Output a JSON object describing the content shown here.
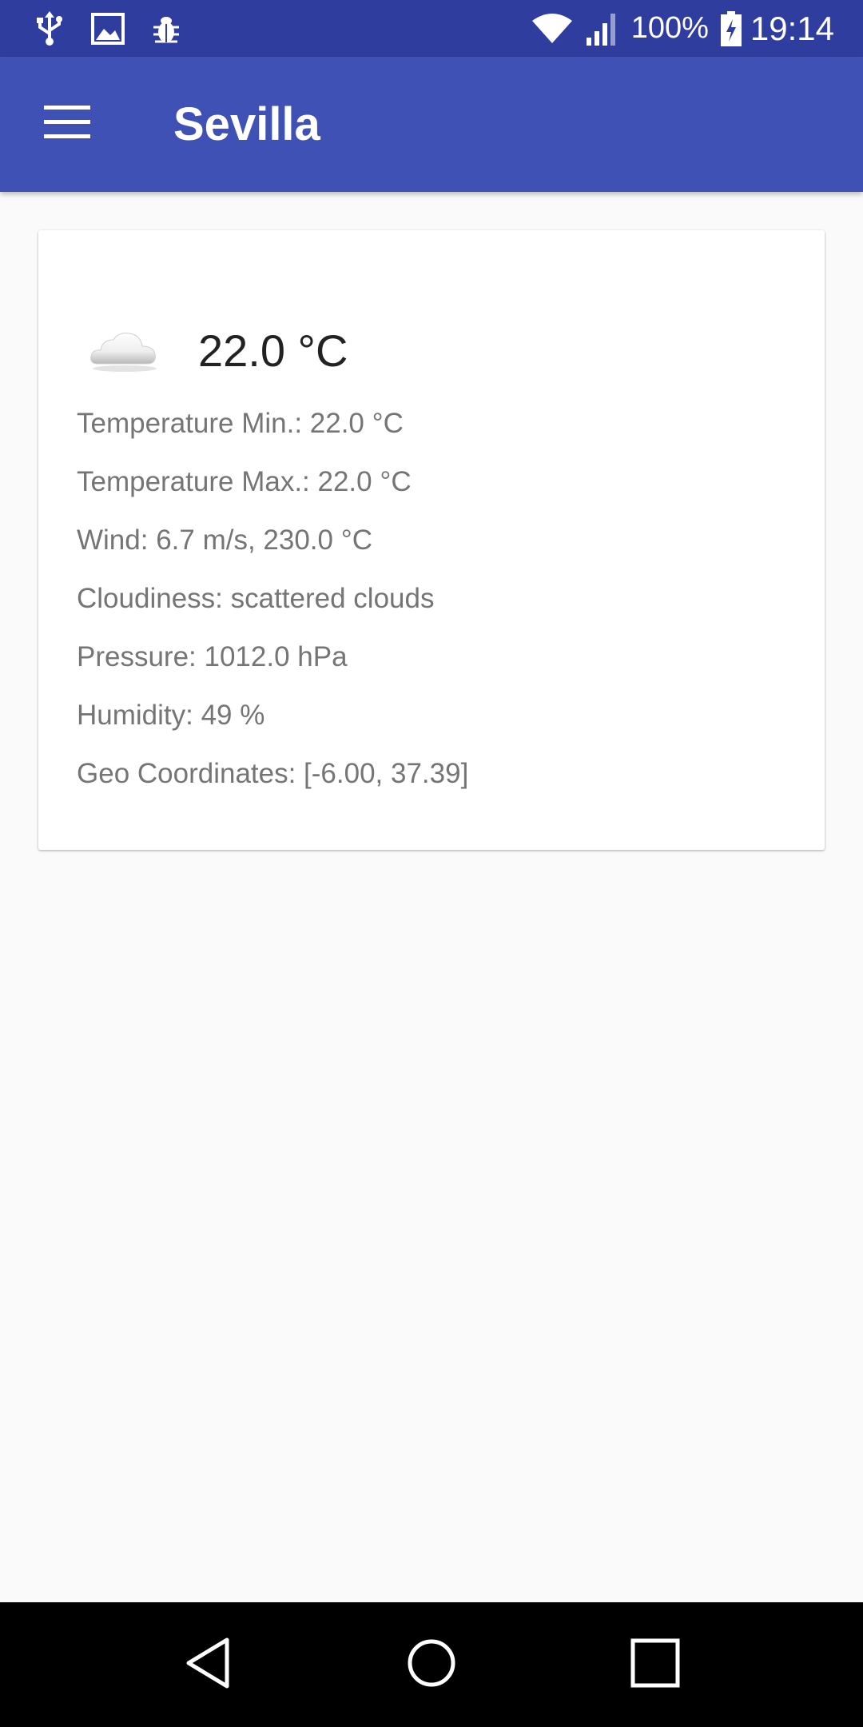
{
  "status_bar": {
    "left_icons": [
      "usb-icon",
      "image-icon",
      "bug-icon"
    ],
    "battery_percent": "100%",
    "time": "19:14",
    "colors": {
      "background": "#2f3e9e"
    }
  },
  "app_bar": {
    "title": "Sevilla",
    "menu_icon": "hamburger-menu-icon",
    "colors": {
      "background": "#3f51b5",
      "text": "#ffffff"
    }
  },
  "weather_card": {
    "icon": "cloud-icon",
    "temperature": "22.0 °C",
    "details": {
      "temp_min": "Temperature Min.: 22.0 °C",
      "temp_max": "Temperature Max.: 22.0 °C",
      "wind": "Wind: 6.7 m/s, 230.0 °C",
      "cloudiness": "Cloudiness: scattered clouds",
      "pressure": "Pressure: 1012.0 hPa",
      "humidity": "Humidity: 49 %",
      "geo": "Geo Coordinates: [-6.00, 37.39]"
    }
  },
  "nav_bar": {
    "buttons": [
      "back-icon",
      "home-icon",
      "recents-icon"
    ]
  }
}
